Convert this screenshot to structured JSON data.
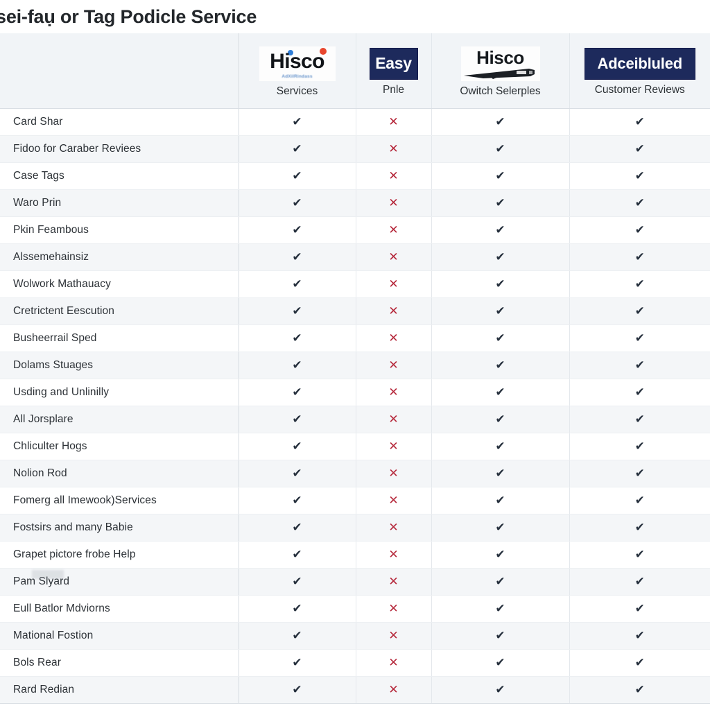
{
  "page": {
    "title": "sei-faụ or Tag Podicle Service"
  },
  "table": {
    "feature_column_header": "",
    "columns": [
      {
        "logo_type": "hisco-dots",
        "logo_word": "Hisco",
        "logo_subtext": "AdXilRindass",
        "label": "Services",
        "accent_blue": "#2f7ed8",
        "accent_red": "#e8462e"
      },
      {
        "logo_type": "navy-box",
        "logo_word": "Easy",
        "label": "Pnle",
        "navy": "#1d2a5c"
      },
      {
        "logo_type": "hisco-swoosh",
        "logo_word": "Hisco",
        "label": "Owitch Selerples"
      },
      {
        "logo_type": "navy-box",
        "logo_word": "Adceibluled",
        "label": "Customer Reviews",
        "navy": "#1d2a5c"
      }
    ],
    "marks": {
      "check": "✔",
      "cross": "✕",
      "check_color": "#26303d",
      "cross_color": "#b5273a"
    },
    "rows": [
      {
        "feature": "Card Shar",
        "values": [
          "check",
          "cross",
          "check",
          "check"
        ]
      },
      {
        "feature": "Fidoo for Caraber Reviees",
        "values": [
          "check",
          "cross",
          "check",
          "check"
        ]
      },
      {
        "feature": "Case Tags",
        "values": [
          "check",
          "cross",
          "check",
          "check"
        ]
      },
      {
        "feature": "Waro Prin",
        "values": [
          "check",
          "cross",
          "check",
          "check"
        ]
      },
      {
        "feature": "Pkin Feambous",
        "values": [
          "check",
          "cross",
          "check",
          "check"
        ]
      },
      {
        "feature": "Alssemehainsiz",
        "values": [
          "check",
          "cross",
          "check",
          "check"
        ]
      },
      {
        "feature": "Wolwork Mathauacy",
        "values": [
          "check",
          "cross",
          "check",
          "check"
        ]
      },
      {
        "feature": "Cretrictent Eescution",
        "values": [
          "check",
          "cross",
          "check",
          "check"
        ]
      },
      {
        "feature": "Busheerrail Sped",
        "values": [
          "check",
          "cross",
          "check",
          "check"
        ]
      },
      {
        "feature": "Dolams Stuages",
        "values": [
          "check",
          "cross",
          "check",
          "check"
        ]
      },
      {
        "feature": "Usding and Unlinilly",
        "values": [
          "check",
          "cross",
          "check",
          "check"
        ]
      },
      {
        "feature": "All Jorsplare",
        "values": [
          "check",
          "cross",
          "check",
          "check"
        ]
      },
      {
        "feature": "Chliculter Hogs",
        "values": [
          "check",
          "cross",
          "check",
          "check"
        ]
      },
      {
        "feature": "Nolion Rod",
        "values": [
          "check",
          "cross",
          "check",
          "check"
        ]
      },
      {
        "feature": "Fomerg all Imewook)Services",
        "values": [
          "check",
          "cross",
          "check",
          "check"
        ]
      },
      {
        "feature": "Fostsirs and many Babie",
        "values": [
          "check",
          "cross",
          "check",
          "check"
        ]
      },
      {
        "feature": "Grapet pictore frobe Help",
        "values": [
          "check",
          "cross",
          "check",
          "check"
        ]
      },
      {
        "feature": "Pam Slyard",
        "values": [
          "check",
          "cross",
          "check",
          "check"
        ]
      },
      {
        "feature": "Eull Batlor Mdviorns",
        "values": [
          "check",
          "cross",
          "check",
          "check"
        ]
      },
      {
        "feature": "Mational Fostion",
        "values": [
          "check",
          "cross",
          "check",
          "check"
        ]
      },
      {
        "feature": "Bols Rear",
        "values": [
          "check",
          "cross",
          "check",
          "check"
        ]
      },
      {
        "feature": "Rard Redian",
        "values": [
          "check",
          "cross",
          "check",
          "check"
        ]
      }
    ]
  }
}
